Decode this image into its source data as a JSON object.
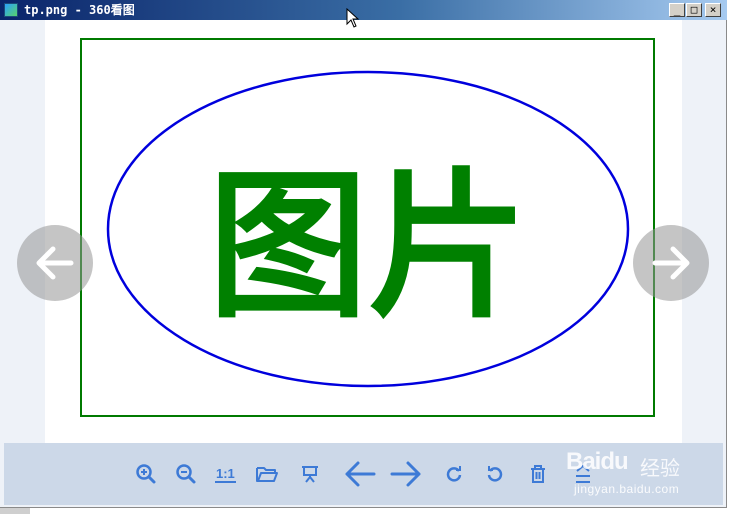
{
  "window": {
    "title": "tp.png - 360看图",
    "app_icon": "image-viewer-icon",
    "controls": {
      "minimize": "_",
      "maximize": "□",
      "close": "×"
    }
  },
  "image": {
    "text": "图片",
    "frame_color": "#007a00",
    "ellipse_color": "#0000dd",
    "text_color": "#008000"
  },
  "navigation": {
    "prev_icon": "arrow-left-icon",
    "next_icon": "arrow-right-icon"
  },
  "toolbar": {
    "actual_size_label": "1:1",
    "icons": [
      "zoom-in-icon",
      "zoom-out-icon",
      "actual-size-icon",
      "open-folder-icon",
      "slideshow-icon",
      "previous-icon",
      "next-icon",
      "rotate-clockwise-icon",
      "rotate-counterclockwise-icon",
      "delete-icon",
      "more-icon"
    ],
    "accent": "#3d7ad6"
  },
  "watermark": {
    "logo": "Baidu",
    "brand": "经验",
    "url": "jingyan.baidu.com"
  }
}
